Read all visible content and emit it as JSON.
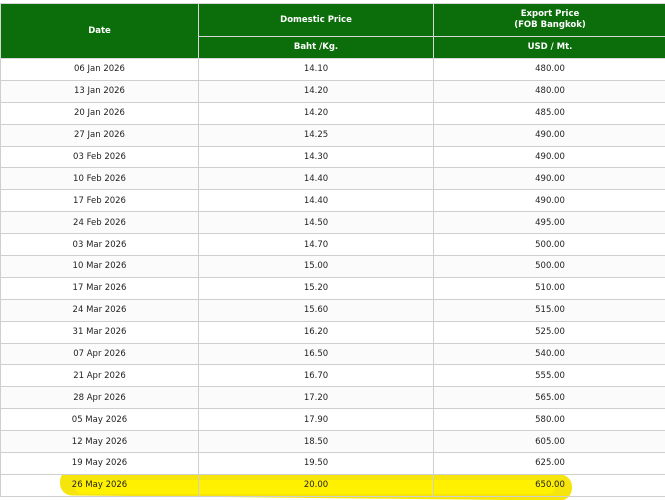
{
  "table": {
    "headers": {
      "date": "Date",
      "domestic": "Domestic Price",
      "export_line1": "Export Price",
      "export_line2": "(FOB Bangkok)",
      "domestic_unit": "Baht /Kg.",
      "export_unit": "USD / Mt."
    },
    "rows": [
      {
        "date": "06 Jan 2026",
        "domestic": "14.10",
        "export": "480.00"
      },
      {
        "date": "13 Jan 2026",
        "domestic": "14.20",
        "export": "480.00"
      },
      {
        "date": "20 Jan 2026",
        "domestic": "14.20",
        "export": "485.00"
      },
      {
        "date": "27 Jan 2026",
        "domestic": "14.25",
        "export": "490.00"
      },
      {
        "date": "03 Feb 2026",
        "domestic": "14.30",
        "export": "490.00"
      },
      {
        "date": "10 Feb 2026",
        "domestic": "14.40",
        "export": "490.00"
      },
      {
        "date": "17 Feb 2026",
        "domestic": "14.40",
        "export": "490.00"
      },
      {
        "date": "24 Feb 2026",
        "domestic": "14.50",
        "export": "495.00"
      },
      {
        "date": "03 Mar 2026",
        "domestic": "14.70",
        "export": "500.00"
      },
      {
        "date": "10 Mar 2026",
        "domestic": "15.00",
        "export": "500.00"
      },
      {
        "date": "17 Mar 2026",
        "domestic": "15.20",
        "export": "510.00"
      },
      {
        "date": "24 Mar 2026",
        "domestic": "15.60",
        "export": "515.00"
      },
      {
        "date": "31 Mar 2026",
        "domestic": "16.20",
        "export": "525.00"
      },
      {
        "date": "07 Apr 2026",
        "domestic": "16.50",
        "export": "540.00"
      },
      {
        "date": "21 Apr 2026",
        "domestic": "16.70",
        "export": "555.00"
      },
      {
        "date": "28 Apr 2026",
        "domestic": "17.20",
        "export": "565.00"
      },
      {
        "date": "05 May 2026",
        "domestic": "17.90",
        "export": "580.00"
      },
      {
        "date": "12 May 2026",
        "domestic": "18.50",
        "export": "605.00"
      },
      {
        "date": "19 May 2026",
        "domestic": "19.50",
        "export": "625.00"
      },
      {
        "date": "26 May 2026",
        "domestic": "20.00",
        "export": "650.00"
      }
    ]
  },
  "highlight_color": "#f6e400",
  "header_color": "#0b6e0b"
}
